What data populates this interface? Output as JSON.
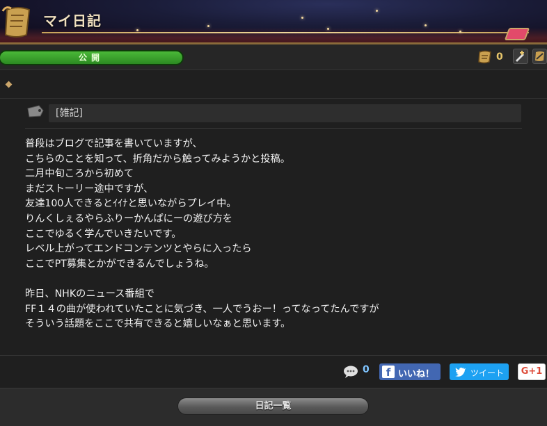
{
  "header": {
    "title": "マイ日記"
  },
  "status": {
    "visibility_label": "公開",
    "subscription_count": "0"
  },
  "entry": {
    "category": "[雑記]",
    "lines": [
      "普段はブログで記事を書いていますが、",
      "こちらのことを知って、折角だから触ってみようかと投稿。",
      "二月中旬ころから初めて",
      "まだストーリー途中ですが、",
      "友達100人できるとｲｲﾅと思いながらプレイ中。",
      "りんくしぇるやらふりーかんぱにーの遊び方を",
      "ここでゆるく学んでいきたいです。",
      "レベル上がってエンドコンテンツとやらに入ったら",
      "ここでPT募集とかができるんでしょうね。",
      "",
      "昨日、NHKのニュース番組で",
      "FF１４の曲が使われていたことに気づき、一人でうおー！ってなってたんですが",
      "そういう話題をここで共有できると嬉しいなぁと思います。"
    ]
  },
  "footer": {
    "comment_count": "0",
    "facebook_label": "いいね！",
    "twitter_label": "ツイート",
    "gplus_label": "G+1",
    "list_button_label": "日記一覧"
  },
  "colors": {
    "public_green": "#3aa52c",
    "gold": "#e7c66b",
    "facebook": "#4267b2",
    "twitter": "#1da1f2"
  },
  "icons": [
    "scroll-icon",
    "subscribe-icon",
    "add-entry-icon",
    "edit-icon",
    "tag-icon",
    "comment-icon",
    "facebook-icon",
    "twitter-icon"
  ]
}
